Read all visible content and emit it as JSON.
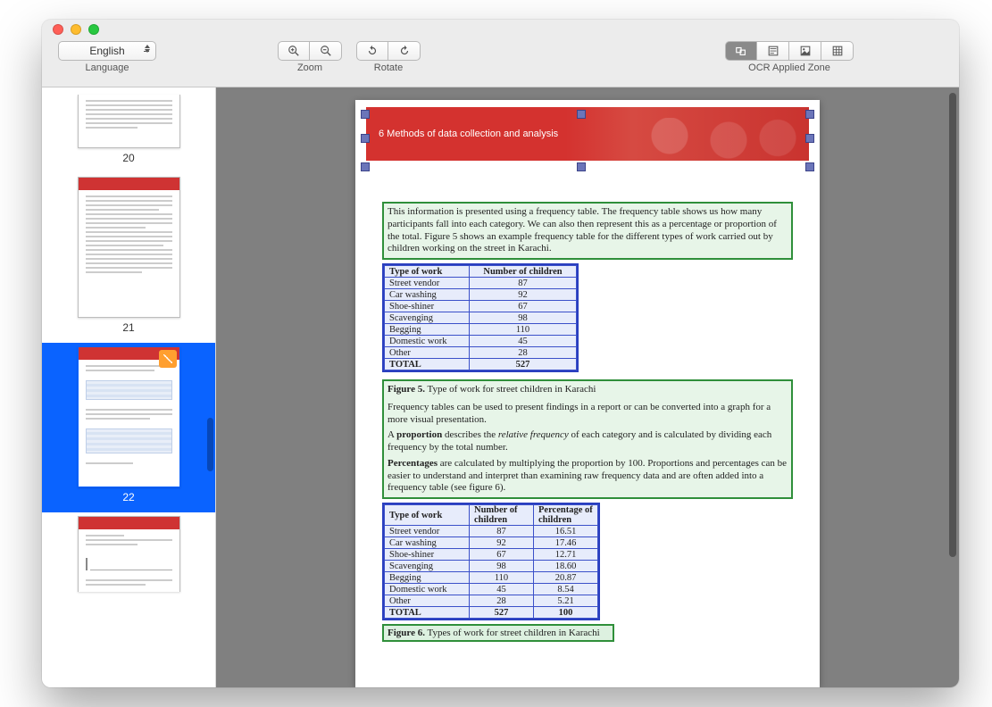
{
  "toolbar": {
    "language": {
      "value": "English",
      "label": "Language"
    },
    "zoom": {
      "label": "Zoom"
    },
    "rotate": {
      "label": "Rotate"
    },
    "ocr": {
      "label": "OCR Applied Zone"
    }
  },
  "thumbnails": [
    {
      "num": "20"
    },
    {
      "num": "21"
    },
    {
      "num": "22",
      "selected": true
    }
  ],
  "page": {
    "banner": "6 Methods of data collection and analysis",
    "para1": "This information is presented using a frequency table. The frequency table shows us how many participants fall into each category. We can also then represent this as a percentage or proportion of the total. Figure 5 shows an example frequency table for the different types of work carried out by children working on the street in Karachi.",
    "table1": {
      "headers": [
        "Type of work",
        "Number of children"
      ],
      "rows": [
        [
          "Street vendor",
          "87"
        ],
        [
          "Car washing",
          "92"
        ],
        [
          "Shoe-shiner",
          "67"
        ],
        [
          "Scavenging",
          "98"
        ],
        [
          "Begging",
          "110"
        ],
        [
          "Domestic work",
          "45"
        ],
        [
          "Other",
          "28"
        ]
      ],
      "total": [
        "TOTAL",
        "527"
      ]
    },
    "fig5_label": "Figure 5.",
    "fig5_text": " Type of work for street children in Karachi",
    "para2a": "Frequency tables can be used to present findings in a report or can be converted into a graph for a more visual presentation.",
    "para2b_pre": "A ",
    "para2b_bold": "proportion",
    "para2b_mid": " describes the ",
    "para2b_ital": "relative frequency",
    "para2b_post": " of each category and is calculated by dividing each frequency by the total number.",
    "para2c_bold": "Percentages",
    "para2c_post": " are calculated by multiplying the proportion by 100. Proportions and percentages can be easier to understand and interpret than examining raw frequency data and are often added into a frequency table (see figure 6).",
    "table2": {
      "headers": [
        "Type of work",
        "Number of children",
        "Percentage of children"
      ],
      "rows": [
        [
          "Street vendor",
          "87",
          "16.51"
        ],
        [
          "Car washing",
          "92",
          "17.46"
        ],
        [
          "Shoe-shiner",
          "67",
          "12.71"
        ],
        [
          "Scavenging",
          "98",
          "18.60"
        ],
        [
          "Begging",
          "110",
          "20.87"
        ],
        [
          "Domestic work",
          "45",
          "8.54"
        ],
        [
          "Other",
          "28",
          "5.21"
        ]
      ],
      "total": [
        "TOTAL",
        "527",
        "100"
      ]
    },
    "fig6_label": "Figure 6.",
    "fig6_text": " Types of work for street children in Karachi"
  }
}
